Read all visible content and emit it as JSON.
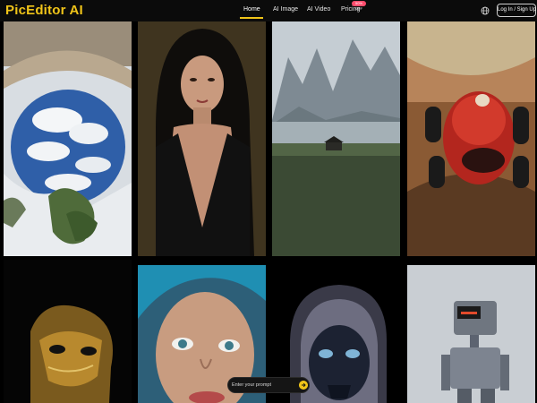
{
  "app": {
    "logo_text": "PicEditor AI"
  },
  "nav": {
    "items": [
      {
        "label": "Home",
        "active": true
      },
      {
        "label": "AI Image",
        "active": false
      },
      {
        "label": "AI Video",
        "active": false
      },
      {
        "label": "Pricing",
        "active": false,
        "badge": "50% OFF"
      }
    ]
  },
  "header": {
    "login_label": "Log In / Sign Up",
    "language_icon": "globe-icon"
  },
  "gallery": {
    "cards": [
      {
        "subject": "Stone arch over snowy rocks and blue cloudy sky"
      },
      {
        "subject": "Portrait of dark-haired woman"
      },
      {
        "subject": "Foggy mountains, lake and a hut on a meadow"
      },
      {
        "subject": "Red vintage race car speeding"
      },
      {
        "subject": "Golden ornate mask"
      },
      {
        "subject": "Blue-haired woman close-up"
      },
      {
        "subject": "Hooded skull figure"
      },
      {
        "subject": "Robot on grey background"
      }
    ]
  },
  "prompt": {
    "placeholder": "Enter your prompt",
    "send_icon": "send-icon"
  },
  "colors": {
    "accent": "#f0c419",
    "background": "#000000",
    "badge": "#ff4d6d"
  }
}
